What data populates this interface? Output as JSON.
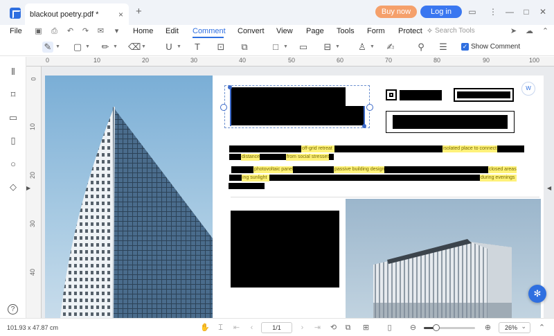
{
  "window": {
    "tab_title": "blackout poetry.pdf *",
    "close_glyph": "×",
    "add_glyph": "+",
    "buy_label": "Buy now",
    "login_label": "Log in",
    "accent_color": "#2f6fe0",
    "buy_color": "#f5a06b"
  },
  "menu": {
    "file": "File",
    "items": [
      "Home",
      "Edit",
      "Comment",
      "Convert",
      "View",
      "Page",
      "Tools",
      "Form",
      "Protect"
    ],
    "active": "Comment",
    "search_placeholder": "Search Tools"
  },
  "toolbar": {
    "show_comment_label": "Show Comment",
    "show_comment_checked": true
  },
  "ruler": {
    "top_labels": [
      "0",
      "10",
      "20",
      "30",
      "40",
      "50",
      "60",
      "70",
      "80",
      "90",
      "100"
    ],
    "left_labels": [
      "0",
      "10",
      "20",
      "30",
      "40"
    ]
  },
  "document": {
    "highlights": [
      "off-grid retreat",
      "isolated place to connect",
      "distance",
      "from social stresses",
      "photovoltaic panels",
      "passive building designs",
      "closed areas",
      "ing sunlight",
      "during evenings"
    ]
  },
  "status": {
    "coordinates": "101.93 x 47.87 cm",
    "page_indicator": "1/1",
    "zoom_level": "26%",
    "zoom_fraction": 0.26
  }
}
